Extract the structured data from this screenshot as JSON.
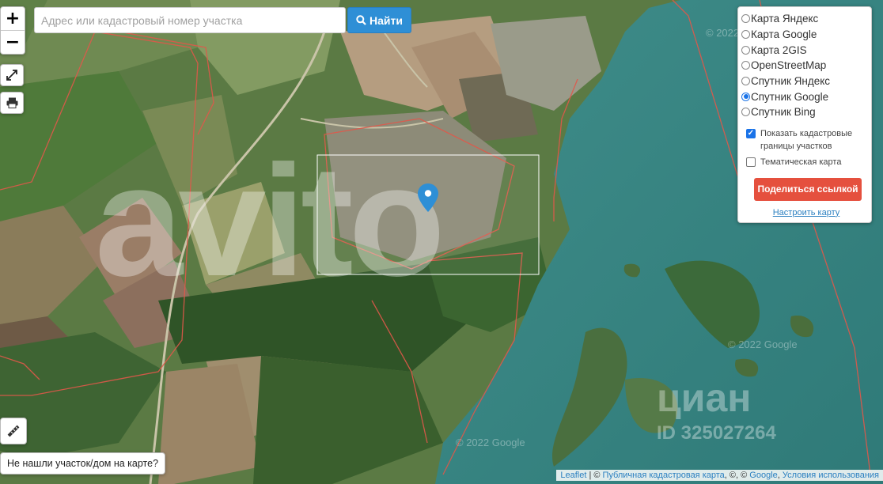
{
  "search": {
    "placeholder": "Адрес или кадастровый номер участка",
    "button_label": "Найти"
  },
  "zoom": {
    "in_label": "+",
    "out_label": "−"
  },
  "layers": [
    {
      "label": "Карта Яндекс",
      "selected": false
    },
    {
      "label": "Карта Google",
      "selected": false
    },
    {
      "label": "Карта 2GIS",
      "selected": false
    },
    {
      "label": "OpenStreetMap",
      "selected": false
    },
    {
      "label": "Спутник Яндекс",
      "selected": false
    },
    {
      "label": "Спутник Google",
      "selected": true
    },
    {
      "label": "Спутник Bing",
      "selected": false
    }
  ],
  "options": {
    "cadastral": {
      "label": "Показать кадастровые границы участков",
      "checked": true
    },
    "thematic": {
      "label": "Тематическая карта",
      "checked": false
    }
  },
  "share_button": "Поделиться ссылкой",
  "settings_link": "Настроить карту",
  "not_found_button": "Не нашли участок/дом на карте?",
  "attribution": {
    "leaflet": "Leaflet",
    "cadastral": "Публичная кадастровая карта",
    "sep": "©, ©",
    "google": "Google",
    "terms": "Условия использования"
  },
  "watermarks": {
    "avito": "avito",
    "cian": "циан",
    "cian_id": "ID 325027264",
    "google": "© 2022 Google"
  },
  "colors": {
    "accent": "#2e8fd6",
    "share": "#e5503e",
    "water": "#3d8a86",
    "boundary": "#e0584a"
  }
}
